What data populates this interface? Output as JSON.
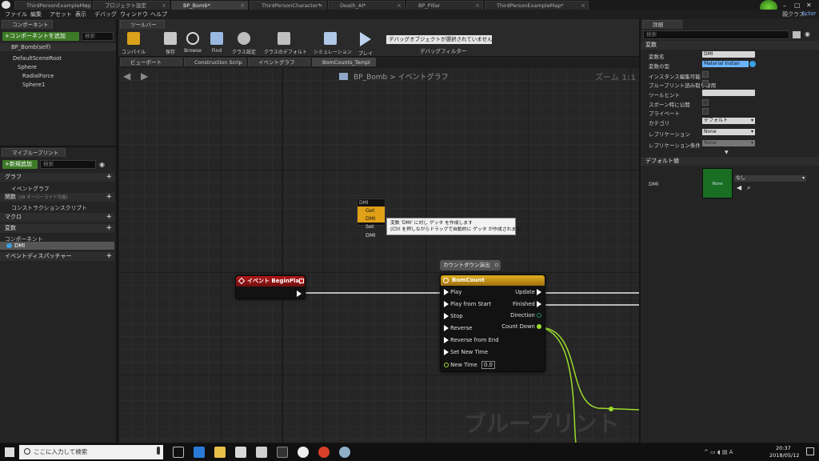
{
  "doc_tabs": [
    "ThirdPersonExampleMap*",
    "プロジェクト設定",
    "BP_Bomb*",
    "ThirdPersonCharacter*",
    "Death_AI*",
    "BP_Pillar",
    "ThirdPersonExampleMap*"
  ],
  "top_right": {
    "parent_class_label": "親クラス:",
    "parent_class_value": "Actor"
  },
  "menu": [
    "ファイル",
    "編集",
    "アセット",
    "表示",
    "デバッグ",
    "ウィンドウ",
    "ヘルプ"
  ],
  "components_panel": {
    "tab": "コンポーネント",
    "add_button": "+コンポーネントを追加",
    "search_placeholder": "検索",
    "self_item": "BP_Bomb(self)",
    "tree": [
      "DefaultSceneRoot",
      "Sphere",
      "RadialForce",
      "Sphere1"
    ]
  },
  "my_blueprint_panel": {
    "tab": "マイブループリント",
    "add_button": "+新規追加",
    "search_placeholder": "検索",
    "graph_section": "グラフ",
    "event_graph": "イベントグラフ",
    "functions_section": "関数",
    "functions_override": "(18 オーバーライド可能)",
    "construction_script": "コンストラクションスクリプト",
    "macros_section": "マクロ",
    "variables_section": "変数",
    "components_subsection": "コンポーネント",
    "dmi_var": "DMI",
    "event_dispatchers": "イベントディスパッチャー"
  },
  "toolbar": {
    "tab": "ツールバー",
    "buttons": [
      "コンパイル",
      "保存",
      "Browse",
      "Find",
      "クラス設定",
      "クラスのデフォルト",
      "シミュレーション",
      "プレイ"
    ],
    "debug_dropdown": "デバッグオブジェクトが選択されていません",
    "debug_filter_label": "デバッグフィルター"
  },
  "graph_tabs": [
    "ビューポート",
    "Construction Scrip",
    "イベントグラフ",
    "BomCounts_Templ"
  ],
  "graph": {
    "breadcrumb_bp": "BP_Bomb",
    "breadcrumb_sep": ">",
    "breadcrumb_graph": "イベントグラフ",
    "zoom": "ズーム 1:1",
    "watermark": "ブループリント",
    "context_menu": {
      "header": "DMI",
      "items": [
        "Get DMI",
        "Set DMI"
      ]
    },
    "tooltip_line1": "変数 'DMI' に対し ゲッタ を作成します",
    "tooltip_line2": "(Ctrl を押しながらドラッグで自動的に ゲッタ が作成されます)",
    "comment": "カウントダウン演出",
    "event_node": {
      "title": "イベント BeginPlay"
    },
    "timeline_node": {
      "title": "BomCount",
      "inputs": [
        "Play",
        "Play from Start",
        "Stop",
        "Reverse",
        "Reverse from End",
        "Set New Time",
        "New Time"
      ],
      "new_time_value": "0.0",
      "outputs": [
        "Update",
        "Finished",
        "Direction",
        "Count Down"
      ]
    }
  },
  "details_panel": {
    "tab": "詳細",
    "search_placeholder": "検索",
    "variable_section": "変数",
    "rows": [
      {
        "label": "変数名",
        "value": "DMI"
      },
      {
        "label": "変数の型",
        "value": "Material Instan"
      },
      {
        "label": "インスタンス編集可能",
        "value": ""
      },
      {
        "label": "ブループリント読み取り専用",
        "value": ""
      },
      {
        "label": "ツールヒント",
        "value": ""
      },
      {
        "label": "スポーン時に公開",
        "value": ""
      },
      {
        "label": "プライベート",
        "value": ""
      },
      {
        "label": "カテゴリ",
        "value": "デフォルト"
      },
      {
        "label": "レプリケーション",
        "value": "None"
      },
      {
        "label": "レプリケーション条件",
        "value": "None"
      }
    ],
    "default_section": "デフォルト値",
    "default_var": "DMI",
    "default_thumb": "None",
    "default_value": "なし"
  },
  "taskbar": {
    "search": "ここに入力して検索",
    "time": "20:37",
    "date": "2018/05/12"
  },
  "colors": {
    "event_header": "#a01414",
    "timeline_header": "#d8a010",
    "accent_green": "#3d7a27",
    "float_wire": "#9bdc2c"
  }
}
